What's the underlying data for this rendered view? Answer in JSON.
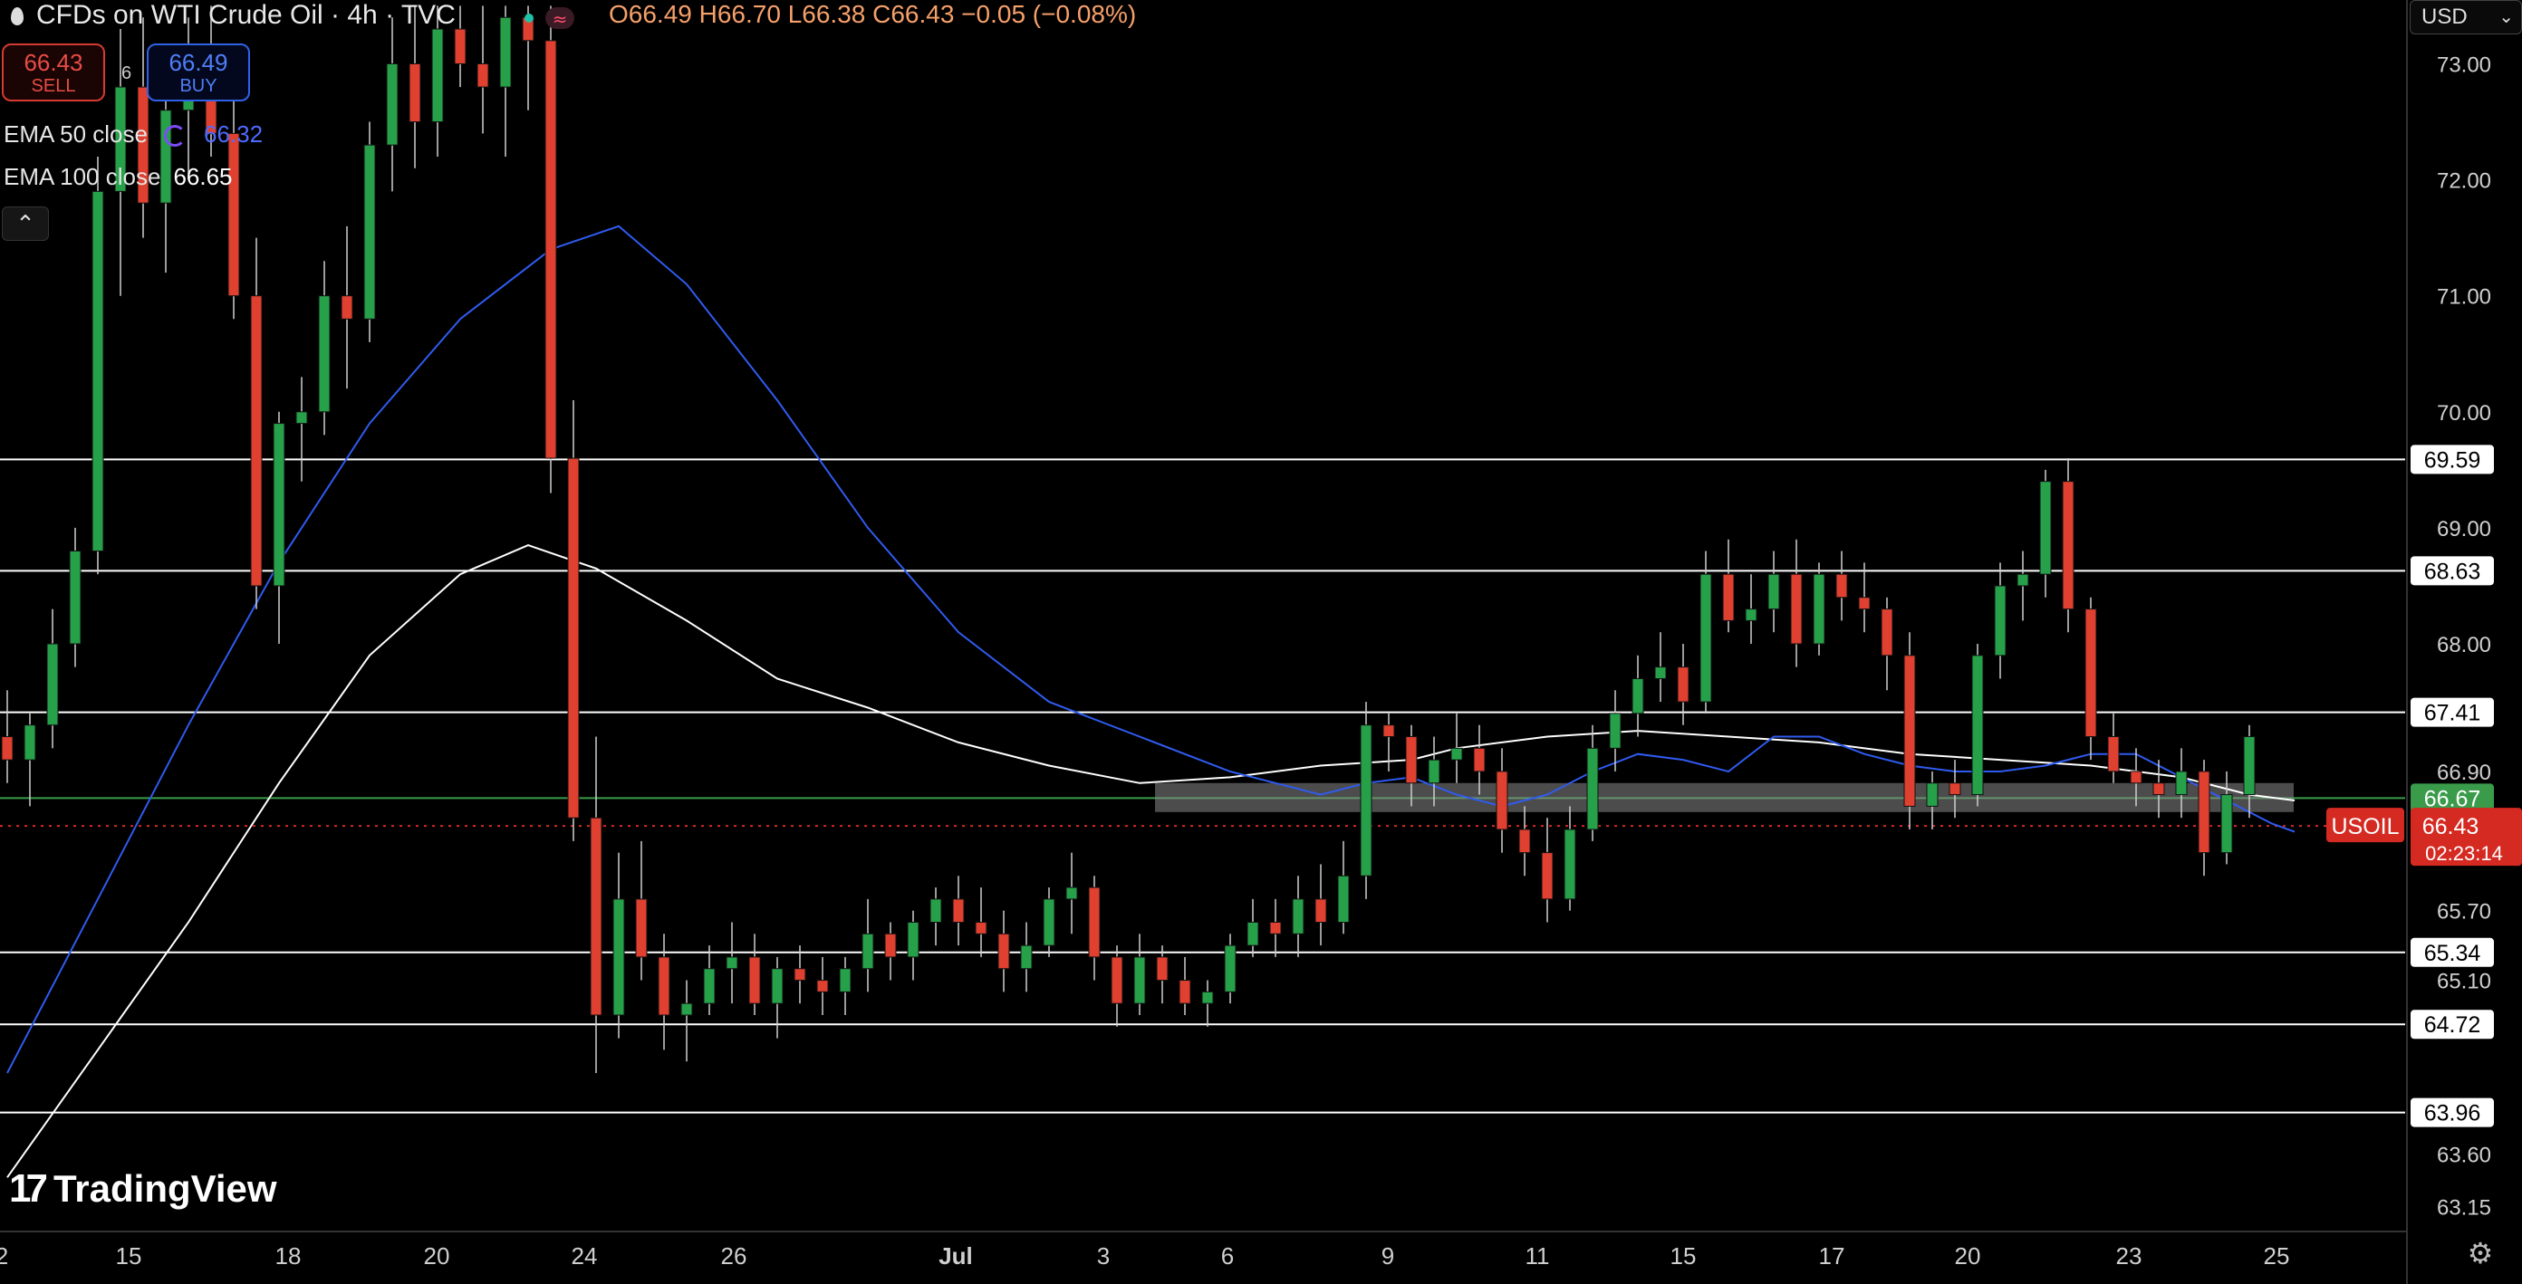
{
  "header": {
    "title": "CFDs on WTI Crude Oil · 4h · TVC",
    "ohlc": "O66.49 H66.70 L66.38 C66.43 −0.05 (−0.08%)"
  },
  "trade": {
    "sell_price": "66.43",
    "sell_label": "SELL",
    "spread": "6",
    "buy_price": "66.49",
    "buy_label": "BUY"
  },
  "indicators": {
    "ema50_label": "EMA 50 close",
    "ema50_value": "66.32",
    "ema100_label": "EMA 100 close",
    "ema100_value": "66.65"
  },
  "branding": {
    "logo_text": "TradingView"
  },
  "axis": {
    "currency": "USD"
  },
  "colors": {
    "up": "#26a14a",
    "down": "#e0402f",
    "ema50": "#2f5bf0",
    "ema100": "#ffffff",
    "price_tag": "#d42a22",
    "level_line": "#ffffff",
    "zone": "#8a8a8a"
  },
  "chart_data": {
    "type": "candlestick",
    "title": "CFDs on WTI Crude Oil · 4h · TVC",
    "symbol": "USOIL",
    "timeframe": "4h",
    "y_range": [
      62.95,
      73.55
    ],
    "y_ticks": [
      "73.00",
      "72.00",
      "71.00",
      "70.00",
      "69.00",
      "68.00",
      "66.90",
      "65.70",
      "65.10",
      "63.60",
      "63.15"
    ],
    "x_ticks": [
      "2",
      "15",
      "18",
      "20",
      "24",
      "26",
      "Jul",
      "3",
      "6",
      "9",
      "11",
      "15",
      "17",
      "20",
      "23",
      "25"
    ],
    "horizontal_levels": [
      69.59,
      68.63,
      67.41,
      65.34,
      64.72,
      63.96
    ],
    "level_labels": [
      "69.59",
      "68.63",
      "67.41",
      "65.34",
      "64.72",
      "63.96"
    ],
    "green_line": {
      "value": 66.67,
      "label": "66.67"
    },
    "zone": [
      66.55,
      66.8
    ],
    "last_price": {
      "value": 66.43,
      "label": "66.43",
      "countdown": "02:23:14",
      "symbol": "USOIL"
    },
    "ema50": [
      [
        0,
        64.3
      ],
      [
        4,
        65.8
      ],
      [
        8,
        67.3
      ],
      [
        12,
        68.7
      ],
      [
        16,
        69.9
      ],
      [
        20,
        70.8
      ],
      [
        24,
        71.4
      ],
      [
        27,
        71.6
      ],
      [
        30,
        71.1
      ],
      [
        34,
        70.1
      ],
      [
        38,
        69.0
      ],
      [
        42,
        68.1
      ],
      [
        46,
        67.5
      ],
      [
        50,
        67.2
      ],
      [
        54,
        66.9
      ],
      [
        58,
        66.7
      ],
      [
        60,
        66.8
      ],
      [
        62,
        66.85
      ],
      [
        64,
        66.7
      ],
      [
        66,
        66.6
      ],
      [
        68,
        66.7
      ],
      [
        70,
        66.9
      ],
      [
        72,
        67.05
      ],
      [
        74,
        67.0
      ],
      [
        76,
        66.9
      ],
      [
        78,
        67.2
      ],
      [
        80,
        67.2
      ],
      [
        82,
        67.05
      ],
      [
        84,
        66.95
      ],
      [
        86,
        66.9
      ],
      [
        88,
        66.9
      ],
      [
        90,
        66.95
      ],
      [
        92,
        67.05
      ],
      [
        94,
        67.05
      ],
      [
        96,
        66.85
      ],
      [
        98,
        66.65
      ],
      [
        100,
        66.45
      ],
      [
        101,
        66.38
      ]
    ],
    "ema100": [
      [
        0,
        63.4
      ],
      [
        4,
        64.5
      ],
      [
        8,
        65.6
      ],
      [
        12,
        66.8
      ],
      [
        16,
        67.9
      ],
      [
        20,
        68.6
      ],
      [
        23,
        68.85
      ],
      [
        26,
        68.65
      ],
      [
        30,
        68.2
      ],
      [
        34,
        67.7
      ],
      [
        38,
        67.45
      ],
      [
        42,
        67.15
      ],
      [
        46,
        66.95
      ],
      [
        50,
        66.8
      ],
      [
        54,
        66.85
      ],
      [
        58,
        66.95
      ],
      [
        62,
        67.0
      ],
      [
        64,
        67.1
      ],
      [
        68,
        67.2
      ],
      [
        72,
        67.25
      ],
      [
        76,
        67.2
      ],
      [
        80,
        67.15
      ],
      [
        84,
        67.05
      ],
      [
        88,
        67.0
      ],
      [
        92,
        66.95
      ],
      [
        96,
        66.85
      ],
      [
        99,
        66.7
      ],
      [
        101,
        66.65
      ]
    ],
    "candles": [
      [
        67.2,
        67.6,
        66.8,
        67.0
      ],
      [
        67.0,
        67.4,
        66.6,
        67.3
      ],
      [
        67.3,
        68.3,
        67.1,
        68.0
      ],
      [
        68.0,
        69.0,
        67.8,
        68.8
      ],
      [
        68.8,
        72.2,
        68.6,
        71.9
      ],
      [
        71.9,
        73.3,
        71.0,
        72.8
      ],
      [
        72.8,
        73.4,
        71.5,
        71.8
      ],
      [
        71.8,
        73.0,
        71.2,
        72.6
      ],
      [
        72.6,
        73.4,
        72.0,
        73.0
      ],
      [
        73.0,
        73.5,
        72.2,
        72.4
      ],
      [
        72.4,
        72.8,
        70.8,
        71.0
      ],
      [
        71.0,
        71.5,
        68.3,
        68.5
      ],
      [
        68.5,
        70.0,
        68.0,
        69.9
      ],
      [
        69.9,
        70.3,
        69.4,
        70.0
      ],
      [
        70.0,
        71.3,
        69.8,
        71.0
      ],
      [
        71.0,
        71.6,
        70.2,
        70.8
      ],
      [
        70.8,
        72.5,
        70.6,
        72.3
      ],
      [
        72.3,
        73.4,
        71.9,
        73.0
      ],
      [
        73.0,
        73.5,
        72.1,
        72.5
      ],
      [
        72.5,
        73.5,
        72.2,
        73.3
      ],
      [
        73.3,
        73.5,
        72.8,
        73.0
      ],
      [
        73.0,
        73.5,
        72.4,
        72.8
      ],
      [
        72.8,
        73.5,
        72.2,
        73.4
      ],
      [
        73.4,
        73.5,
        72.6,
        73.2
      ],
      [
        73.2,
        73.5,
        69.3,
        69.6
      ],
      [
        69.6,
        70.1,
        66.3,
        66.5
      ],
      [
        66.5,
        67.2,
        64.3,
        64.8
      ],
      [
        64.8,
        66.2,
        64.6,
        65.8
      ],
      [
        65.8,
        66.3,
        65.1,
        65.3
      ],
      [
        65.3,
        65.5,
        64.5,
        64.8
      ],
      [
        64.8,
        65.1,
        64.4,
        64.9
      ],
      [
        64.9,
        65.4,
        64.8,
        65.2
      ],
      [
        65.2,
        65.6,
        64.9,
        65.3
      ],
      [
        65.3,
        65.5,
        64.8,
        64.9
      ],
      [
        64.9,
        65.3,
        64.6,
        65.2
      ],
      [
        65.2,
        65.4,
        64.9,
        65.1
      ],
      [
        65.1,
        65.3,
        64.8,
        65.0
      ],
      [
        65.0,
        65.3,
        64.8,
        65.2
      ],
      [
        65.2,
        65.8,
        65.0,
        65.5
      ],
      [
        65.5,
        65.6,
        65.1,
        65.3
      ],
      [
        65.3,
        65.7,
        65.1,
        65.6
      ],
      [
        65.6,
        65.9,
        65.4,
        65.8
      ],
      [
        65.8,
        66.0,
        65.4,
        65.6
      ],
      [
        65.6,
        65.9,
        65.3,
        65.5
      ],
      [
        65.5,
        65.7,
        65.0,
        65.2
      ],
      [
        65.2,
        65.6,
        65.0,
        65.4
      ],
      [
        65.4,
        65.9,
        65.3,
        65.8
      ],
      [
        65.8,
        66.2,
        65.5,
        65.9
      ],
      [
        65.9,
        66.0,
        65.1,
        65.3
      ],
      [
        65.3,
        65.4,
        64.7,
        64.9
      ],
      [
        64.9,
        65.5,
        64.8,
        65.3
      ],
      [
        65.3,
        65.4,
        64.9,
        65.1
      ],
      [
        65.1,
        65.3,
        64.8,
        64.9
      ],
      [
        64.9,
        65.1,
        64.7,
        65.0
      ],
      [
        65.0,
        65.5,
        64.9,
        65.4
      ],
      [
        65.4,
        65.8,
        65.3,
        65.6
      ],
      [
        65.6,
        65.8,
        65.3,
        65.5
      ],
      [
        65.5,
        66.0,
        65.3,
        65.8
      ],
      [
        65.8,
        66.1,
        65.4,
        65.6
      ],
      [
        65.6,
        66.3,
        65.5,
        66.0
      ],
      [
        66.0,
        67.5,
        65.8,
        67.3
      ],
      [
        67.3,
        67.4,
        66.9,
        67.2
      ],
      [
        67.2,
        67.3,
        66.6,
        66.8
      ],
      [
        66.8,
        67.2,
        66.6,
        67.0
      ],
      [
        67.0,
        67.4,
        66.8,
        67.1
      ],
      [
        67.1,
        67.3,
        66.7,
        66.9
      ],
      [
        66.9,
        67.1,
        66.2,
        66.4
      ],
      [
        66.4,
        66.6,
        66.0,
        66.2
      ],
      [
        66.2,
        66.5,
        65.6,
        65.8
      ],
      [
        65.8,
        66.6,
        65.7,
        66.4
      ],
      [
        66.4,
        67.3,
        66.3,
        67.1
      ],
      [
        67.1,
        67.6,
        66.9,
        67.4
      ],
      [
        67.4,
        67.9,
        67.2,
        67.7
      ],
      [
        67.7,
        68.1,
        67.5,
        67.8
      ],
      [
        67.8,
        68.0,
        67.3,
        67.5
      ],
      [
        67.5,
        68.8,
        67.4,
        68.6
      ],
      [
        68.6,
        68.9,
        68.1,
        68.2
      ],
      [
        68.2,
        68.6,
        68.0,
        68.3
      ],
      [
        68.3,
        68.8,
        68.1,
        68.6
      ],
      [
        68.6,
        68.9,
        67.8,
        68.0
      ],
      [
        68.0,
        68.7,
        67.9,
        68.6
      ],
      [
        68.6,
        68.8,
        68.2,
        68.4
      ],
      [
        68.4,
        68.7,
        68.1,
        68.3
      ],
      [
        68.3,
        68.4,
        67.6,
        67.9
      ],
      [
        67.9,
        68.1,
        66.4,
        66.6
      ],
      [
        66.6,
        66.9,
        66.4,
        66.8
      ],
      [
        66.8,
        67.0,
        66.5,
        66.7
      ],
      [
        66.7,
        68.0,
        66.6,
        67.9
      ],
      [
        67.9,
        68.7,
        67.7,
        68.5
      ],
      [
        68.5,
        68.8,
        68.2,
        68.6
      ],
      [
        68.6,
        69.5,
        68.4,
        69.4
      ],
      [
        69.4,
        69.6,
        68.1,
        68.3
      ],
      [
        68.3,
        68.4,
        67.0,
        67.2
      ],
      [
        67.2,
        67.4,
        66.8,
        66.9
      ],
      [
        66.9,
        67.1,
        66.6,
        66.8
      ],
      [
        66.8,
        67.0,
        66.5,
        66.7
      ],
      [
        66.7,
        67.1,
        66.5,
        66.9
      ],
      [
        66.9,
        67.0,
        66.0,
        66.2
      ],
      [
        66.2,
        66.9,
        66.1,
        66.7
      ],
      [
        66.7,
        67.3,
        66.5,
        67.2
      ]
    ]
  }
}
